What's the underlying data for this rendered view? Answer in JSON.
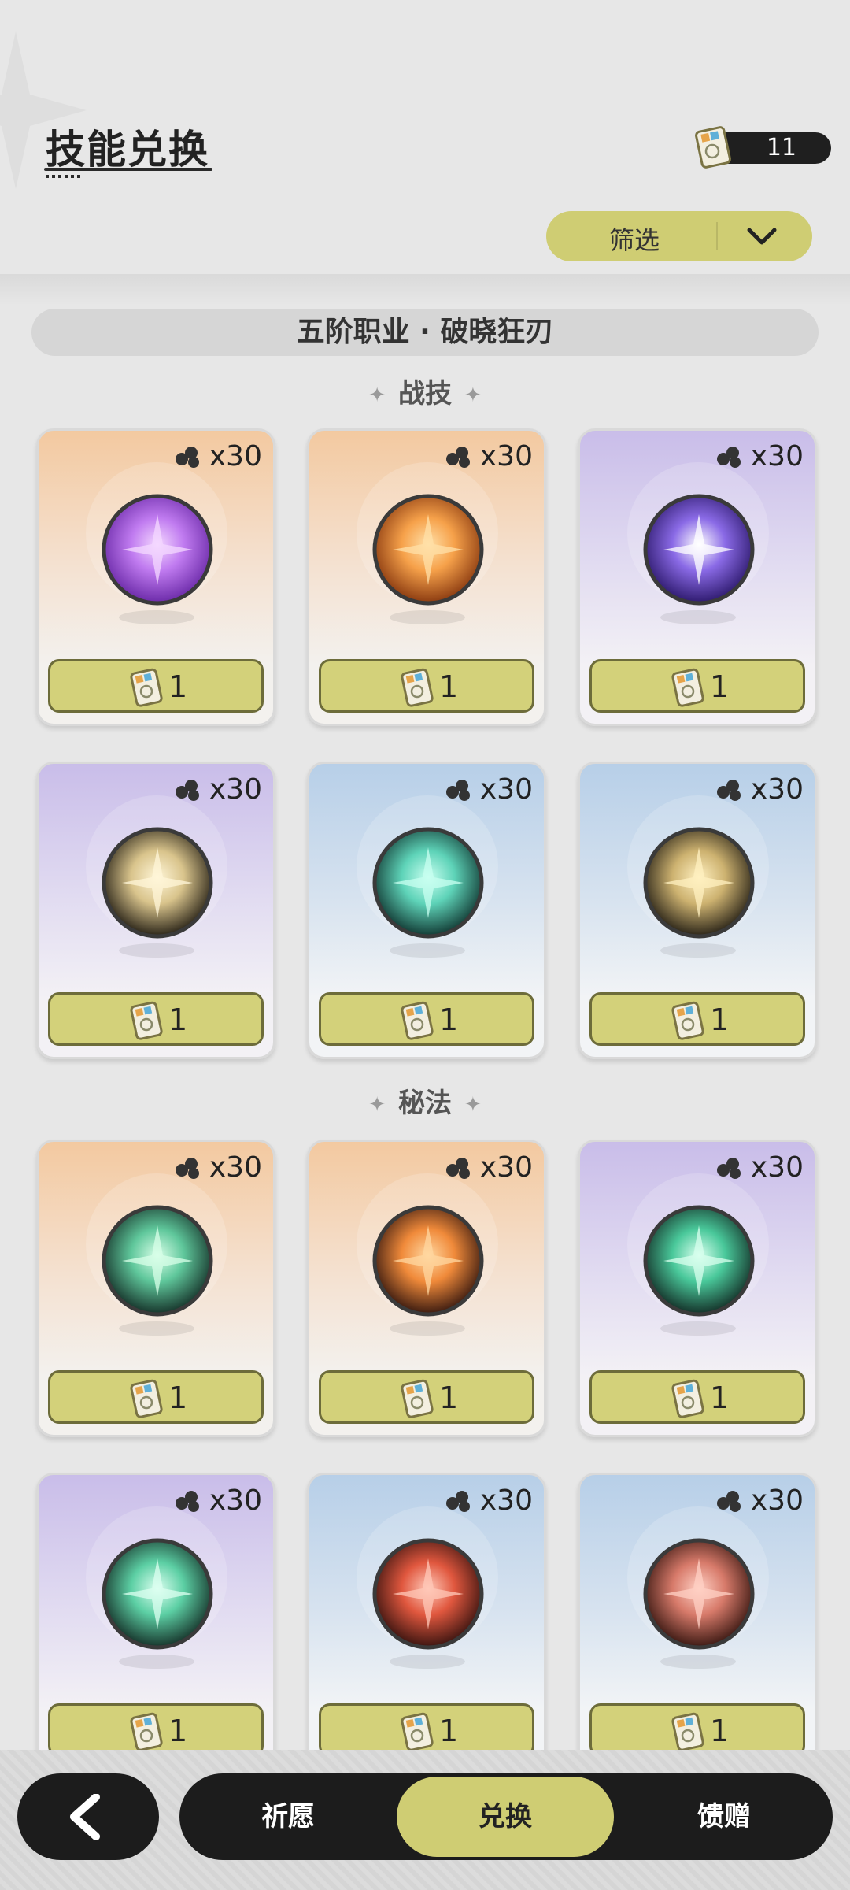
{
  "header": {
    "title": "技能兑换"
  },
  "currency": {
    "count": "11",
    "icon": "skill-ticket-icon"
  },
  "filter": {
    "label": "筛选",
    "icon": "chevron-down-icon"
  },
  "class_bar": {
    "label": "五阶职业 · 破晓狂刃"
  },
  "sections": [
    {
      "title": "战技",
      "decor": "✦"
    },
    {
      "title": "秘法",
      "decor": "✦"
    }
  ],
  "cards": [
    {
      "qty": "x30",
      "price": "1",
      "theme": "orange",
      "orb": "purple-burst"
    },
    {
      "qty": "x30",
      "price": "1",
      "theme": "orange",
      "orb": "orange-vortex"
    },
    {
      "qty": "x30",
      "price": "1",
      "theme": "purple",
      "orb": "violet-star"
    },
    {
      "qty": "x30",
      "price": "1",
      "theme": "purple",
      "orb": "gold-star"
    },
    {
      "qty": "x30",
      "price": "1",
      "theme": "blue",
      "orb": "teal-ring"
    },
    {
      "qty": "x30",
      "price": "1",
      "theme": "blue",
      "orb": "gold-crescent"
    },
    {
      "qty": "x30",
      "price": "1",
      "theme": "orange",
      "orb": "green-arrows"
    },
    {
      "qty": "x30",
      "price": "1",
      "theme": "orange",
      "orb": "fire-figure"
    },
    {
      "qty": "x30",
      "price": "1",
      "theme": "purple",
      "orb": "green-leaf"
    },
    {
      "qty": "x30",
      "price": "1",
      "theme": "purple",
      "orb": "green-crown"
    },
    {
      "qty": "x30",
      "price": "1",
      "theme": "blue",
      "orb": "red-figure"
    },
    {
      "qty": "x30",
      "price": "1",
      "theme": "blue",
      "orb": "red-flame"
    }
  ],
  "nav": {
    "back_icon": "back-arrow-icon",
    "tabs": [
      {
        "label": "祈愿"
      },
      {
        "label": "兑换",
        "active": true
      },
      {
        "label": "馈赠"
      }
    ]
  },
  "colors": {
    "accent": "#cfcd73",
    "dark": "#1c1c1c",
    "background": "#e7e7e7"
  }
}
